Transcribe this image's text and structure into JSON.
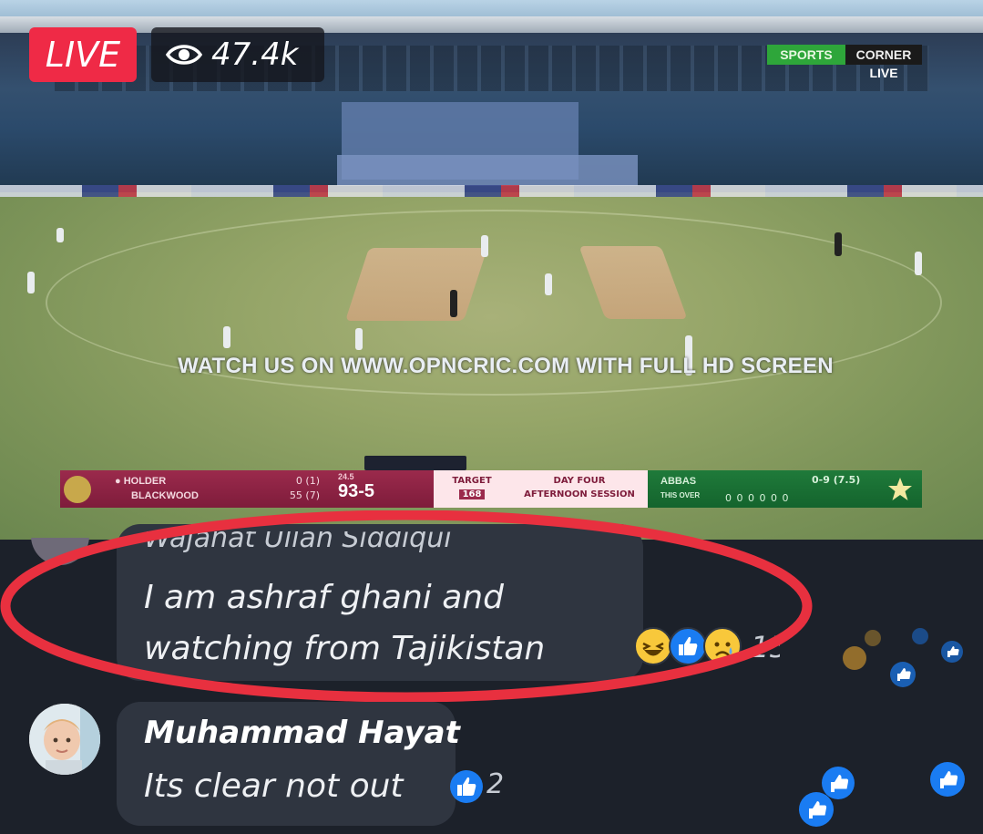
{
  "stream": {
    "live_label": "LIVE",
    "viewer_count": "47.4k",
    "channel_logo": {
      "left": "SPORTS",
      "right": "CORNER",
      "sub": "LIVE"
    },
    "overlay_text": "WATCH US ON WWW.OPNCRIC.COM WITH FULL HD SCREEN"
  },
  "scoreboard": {
    "batter1": "● HOLDER",
    "batter2": "BLACKWOOD",
    "batter1_balls": "0 (1)",
    "batter2_balls": "55 (7)",
    "overs": "24.5",
    "score": "93-5",
    "target_label": "TARGET",
    "target_value": "168",
    "day_label": "DAY FOUR",
    "session_label": "AFTERNOON SESSION",
    "bowler": "ABBAS",
    "bowler_sub": "THIS OVER",
    "bowler_figures": "0-9 (7.5)",
    "this_over_dots": "0 0 0 0 0 0",
    "colors": {
      "home": "#8e2447",
      "mid": "#fde6ea",
      "away": "#1a6f34"
    }
  },
  "comments": [
    {
      "author": "Wajahat Ullah Siddiqui",
      "text_lines": [
        "I am ashraf ghani and",
        "watching from Tajikistan"
      ],
      "reactions": [
        "laugh-icon",
        "like-icon",
        "sad-icon"
      ],
      "reaction_count": "15"
    },
    {
      "author": "Muhammad Hayat",
      "text": "Its clear not out",
      "reactions": [
        "like-icon"
      ],
      "reaction_count": "2"
    }
  ],
  "highlight_color": "#e8303f"
}
